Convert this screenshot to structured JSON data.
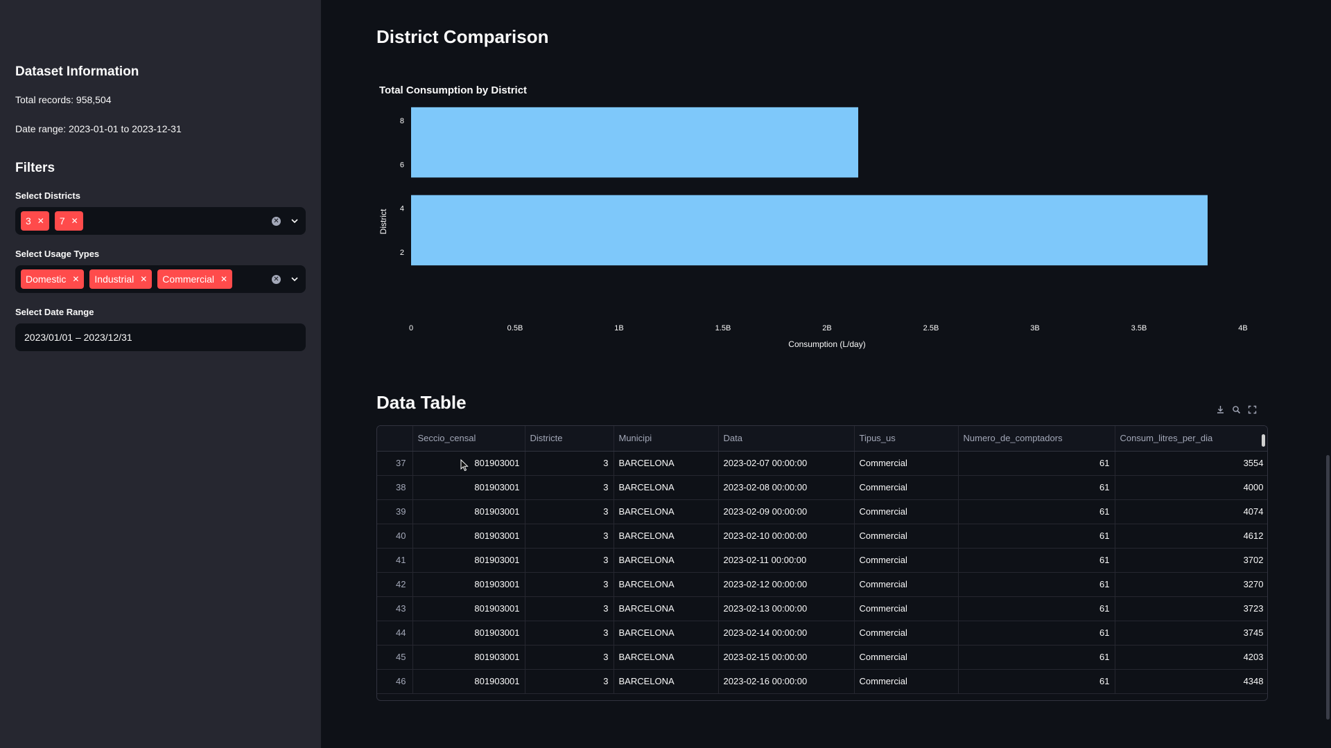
{
  "sidebar": {
    "dataset_title": "Dataset Information",
    "total_records": "Total records: 958,504",
    "date_range": "Date range: 2023-01-01 to 2023-12-31",
    "filters_title": "Filters",
    "districts_label": "Select Districts",
    "districts_selected": [
      "3",
      "7"
    ],
    "usage_label": "Select Usage Types",
    "usage_selected": [
      "Domestic",
      "Industrial",
      "Commercial"
    ],
    "date_label": "Select Date Range",
    "date_value": "2023/01/01 – 2023/12/31"
  },
  "main": {
    "comparison_title": "District Comparison",
    "table_title": "Data Table"
  },
  "chart_data": {
    "type": "bar",
    "orientation": "horizontal",
    "title": "Total Consumption by District",
    "xlabel": "Consumption (L/day)",
    "ylabel": "District",
    "bars": [
      {
        "district": 3,
        "value": 3830000000
      },
      {
        "district": 7,
        "value": 2150000000
      }
    ],
    "xlim": [
      0,
      4000000000
    ],
    "ylim": [
      1.5,
      8.5
    ],
    "xticks": [
      0,
      500000000,
      1000000000,
      1500000000,
      2000000000,
      2500000000,
      3000000000,
      3500000000,
      4000000000
    ],
    "xtick_labels": [
      "0",
      "0.5B",
      "1B",
      "1.5B",
      "2B",
      "2.5B",
      "3B",
      "3.5B",
      "4B"
    ],
    "yticks": [
      2,
      4,
      6,
      8
    ],
    "ytick_labels": [
      "2",
      "4",
      "6",
      "8"
    ],
    "bar_color": "#7ec8fa",
    "grid": false
  },
  "table": {
    "columns": [
      "",
      "Seccio_censal",
      "Districte",
      "Municipi",
      "Data",
      "Tipus_us",
      "Numero_de_comptadors",
      "Consum_litres_per_dia"
    ],
    "rows": [
      [
        "37",
        "801903001",
        "3",
        "BARCELONA",
        "2023-02-07 00:00:00",
        "Commercial",
        "61",
        "3554"
      ],
      [
        "38",
        "801903001",
        "3",
        "BARCELONA",
        "2023-02-08 00:00:00",
        "Commercial",
        "61",
        "4000"
      ],
      [
        "39",
        "801903001",
        "3",
        "BARCELONA",
        "2023-02-09 00:00:00",
        "Commercial",
        "61",
        "4074"
      ],
      [
        "40",
        "801903001",
        "3",
        "BARCELONA",
        "2023-02-10 00:00:00",
        "Commercial",
        "61",
        "4612"
      ],
      [
        "41",
        "801903001",
        "3",
        "BARCELONA",
        "2023-02-11 00:00:00",
        "Commercial",
        "61",
        "3702"
      ],
      [
        "42",
        "801903001",
        "3",
        "BARCELONA",
        "2023-02-12 00:00:00",
        "Commercial",
        "61",
        "3270"
      ],
      [
        "43",
        "801903001",
        "3",
        "BARCELONA",
        "2023-02-13 00:00:00",
        "Commercial",
        "61",
        "3723"
      ],
      [
        "44",
        "801903001",
        "3",
        "BARCELONA",
        "2023-02-14 00:00:00",
        "Commercial",
        "61",
        "3745"
      ],
      [
        "45",
        "801903001",
        "3",
        "BARCELONA",
        "2023-02-15 00:00:00",
        "Commercial",
        "61",
        "4203"
      ],
      [
        "46",
        "801903001",
        "3",
        "BARCELONA",
        "2023-02-16 00:00:00",
        "Commercial",
        "61",
        "4348"
      ]
    ],
    "toolbar_icons": [
      "download-icon",
      "search-icon",
      "fullscreen-icon"
    ]
  },
  "colors": {
    "accent": "#ff4b4b",
    "sidebar_bg": "#262730",
    "main_bg": "#0e1117",
    "bar": "#7ec8fa"
  }
}
